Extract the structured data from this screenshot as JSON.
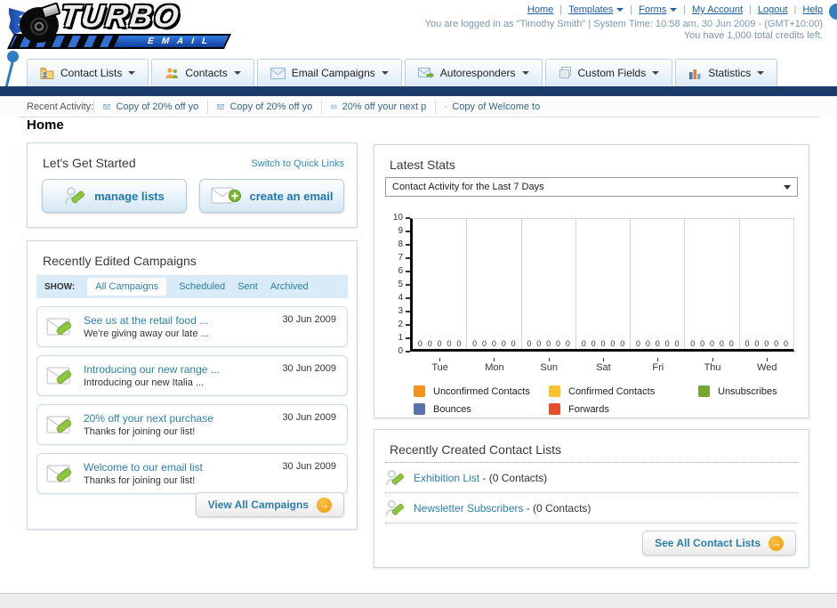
{
  "header": {
    "separator": "|",
    "links": [
      {
        "label": "Home",
        "has_menu": false
      },
      {
        "label": "Templates",
        "has_menu": true
      },
      {
        "label": "Forms",
        "has_menu": true
      },
      {
        "label": "My Account",
        "has_menu": false
      },
      {
        "label": "Logout",
        "has_menu": false
      },
      {
        "label": "Help",
        "has_menu": false
      }
    ],
    "login_info": "You are logged in as \"Timothy Smith\" | System Time: 10:58 am, 30 Jun 2009 - (GMT+10:00)",
    "credits_info": "You have 1,000 total credits left.",
    "logo_title": "TURBO",
    "logo_subtitle": "EMAIL"
  },
  "nav": {
    "tabs": [
      {
        "label": "Contact Lists",
        "icon": "folder-user-icon"
      },
      {
        "label": "Contacts",
        "icon": "users-icon"
      },
      {
        "label": "Email Campaigns",
        "icon": "envelope-icon"
      },
      {
        "label": "Autoresponders",
        "icon": "envelope-arrow-icon"
      },
      {
        "label": "Custom Fields",
        "icon": "pages-icon"
      },
      {
        "label": "Statistics",
        "icon": "bar-chart-icon"
      }
    ]
  },
  "activity": {
    "label": "Recent Activity:",
    "items": [
      "Copy of 20% off yo",
      "Copy of 20% off yo",
      "20% off your next p",
      "Copy of Welcome to"
    ]
  },
  "page_title": "Home",
  "get_started": {
    "title": "Let's Get Started",
    "switch_link": "Switch to Quick Links",
    "manage_lists_label": "manage lists",
    "create_email_label": "create an email"
  },
  "campaigns": {
    "title": "Recently Edited Campaigns",
    "show_label": "SHOW:",
    "filters": [
      "All Campaigns",
      "Scheduled",
      "Sent",
      "Archived"
    ],
    "active_filter": "All Campaigns",
    "items": [
      {
        "title": "See us at the retail food ...",
        "subtitle": "We're giving away our late ...",
        "date": "30 Jun 2009"
      },
      {
        "title": "Introducing our new range ...",
        "subtitle": "Introducing our new Italia ...",
        "date": "30 Jun 2009"
      },
      {
        "title": "20% off your next purchase",
        "subtitle": "Thanks for joining our list!",
        "date": "30 Jun 2009"
      },
      {
        "title": "Welcome to our email list",
        "subtitle": "Thanks for joining our list!",
        "date": "30 Jun 2009"
      }
    ],
    "view_all_label": "View All Campaigns",
    "arrow_glyph": "→"
  },
  "stats": {
    "title": "Latest Stats",
    "dropdown_value": "Contact Activity for the Last 7 Days"
  },
  "chart_data": {
    "type": "bar",
    "title": "Contact Activity for the Last 7 Days",
    "categories": [
      "Tue",
      "Mon",
      "Sun",
      "Sat",
      "Fri",
      "Thu",
      "Wed"
    ],
    "series": [
      {
        "name": "Unconfirmed Contacts",
        "color": "#F6921E",
        "values": [
          0,
          0,
          0,
          0,
          0,
          0,
          0
        ]
      },
      {
        "name": "Confirmed Contacts",
        "color": "#FCC32E",
        "values": [
          0,
          0,
          0,
          0,
          0,
          0,
          0
        ]
      },
      {
        "name": "Unsubscribes",
        "color": "#76A733",
        "values": [
          0,
          0,
          0,
          0,
          0,
          0,
          0
        ]
      },
      {
        "name": "Bounces",
        "color": "#5873AE",
        "values": [
          0,
          0,
          0,
          0,
          0,
          0,
          0
        ]
      },
      {
        "name": "Forwards",
        "color": "#E44D26",
        "values": [
          0,
          0,
          0,
          0,
          0,
          0,
          0
        ]
      }
    ],
    "ylim": [
      0,
      10
    ],
    "yticks": [
      0,
      1,
      2,
      3,
      4,
      5,
      6,
      7,
      8,
      9,
      10
    ],
    "grid": "vertical",
    "legend_position": "bottom"
  },
  "contact_lists": {
    "title": "Recently Created Contact Lists",
    "items": [
      {
        "name": "Exhibition List",
        "detail": "- (0 Contacts)"
      },
      {
        "name": "Newsletter Subscribers",
        "detail": "- (0 Contacts)"
      }
    ],
    "see_all_label": "See All Contact Lists",
    "arrow_glyph": "→"
  },
  "colors": {
    "accent_blue": "#2D7EC3",
    "navy_bar": "#1B3C68",
    "link_blue": "#2D7FB0",
    "button_orange": "#F5A11C"
  }
}
